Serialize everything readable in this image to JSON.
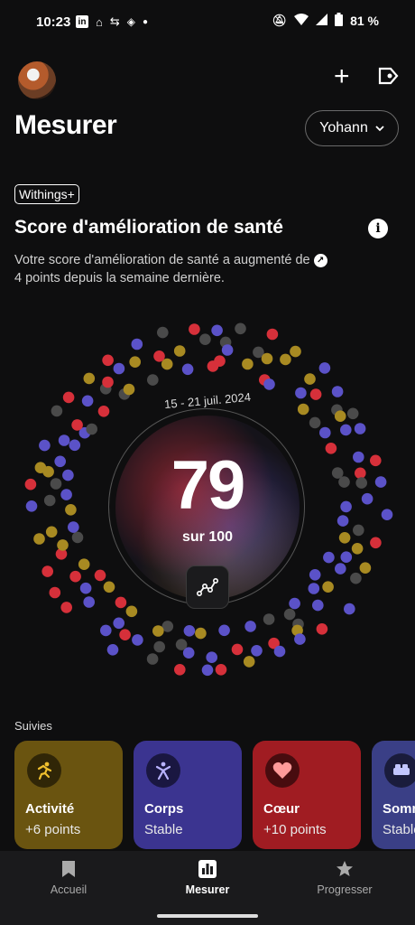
{
  "status": {
    "time": "10:23",
    "battery": "81 %"
  },
  "header": {
    "title": "Mesurer",
    "user": "Yohann",
    "plus": "+"
  },
  "badge": "Withings+",
  "score_section": {
    "title": "Score d'amélioration de santé",
    "description_line1": "Votre score d'amélioration de santé a augmenté de",
    "description_line2": "4 points depuis la semaine dernière.",
    "date_range": "15 - 21 juil. 2024",
    "score": "79",
    "out_of": "sur 100"
  },
  "suivies": {
    "heading": "Suivies",
    "cards": [
      {
        "title": "Activité",
        "subtitle": "+6 points",
        "color": "#6a5410",
        "icon": "running-icon"
      },
      {
        "title": "Corps",
        "subtitle": "Stable",
        "color": "#3b3490",
        "icon": "body-icon"
      },
      {
        "title": "Cœur",
        "subtitle": "+10 points",
        "color": "#a01c22",
        "icon": "heart-icon"
      },
      {
        "title": "Sommeil",
        "subtitle": "Stable",
        "color": "#3a3f86",
        "icon": "bed-icon"
      }
    ]
  },
  "nav": [
    {
      "label": "Accueil",
      "icon": "bookmark-icon"
    },
    {
      "label": "Mesurer",
      "icon": "chart-icon"
    },
    {
      "label": "Progresser",
      "icon": "star-icon"
    }
  ],
  "colors": {
    "red": "#d6303a",
    "blue": "#5b52c8",
    "gold": "#a88a22",
    "gray": "#4a4a4a"
  }
}
